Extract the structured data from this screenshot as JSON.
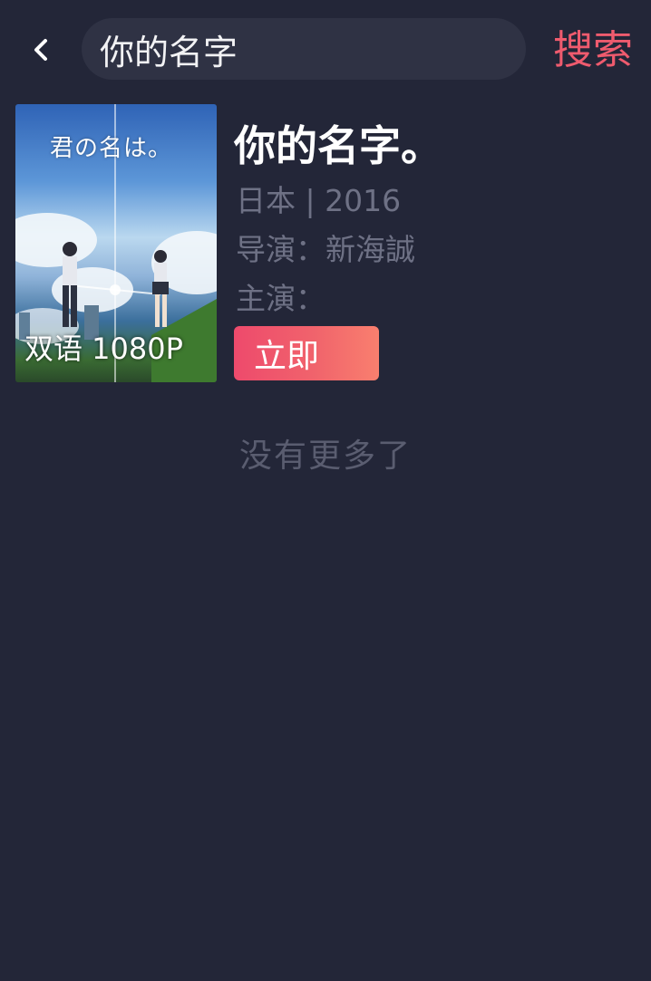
{
  "header": {
    "back_icon": "chevron-left-icon",
    "search_value": "你的名字",
    "search_button_label": "搜索",
    "accent_color": "#ef5b6e"
  },
  "results": [
    {
      "poster": {
        "title_art": "君の名は。",
        "badge": "双语 1080P"
      },
      "title": "你的名字。",
      "meta_country": "日本",
      "meta_separator": "|",
      "meta_year": "2016",
      "director_label": "导演：",
      "director": "新海誠",
      "cast_label": "主演：",
      "cast": "",
      "play_button_label": "立即"
    }
  ],
  "footer": {
    "no_more_text": "没有更多了"
  },
  "colors": {
    "background": "#232638",
    "search_box": "#2f3244",
    "meta_text": "#6e7185",
    "play_button_gradient_start": "#ee4a6c",
    "play_button_gradient_end": "#f97f6e"
  }
}
